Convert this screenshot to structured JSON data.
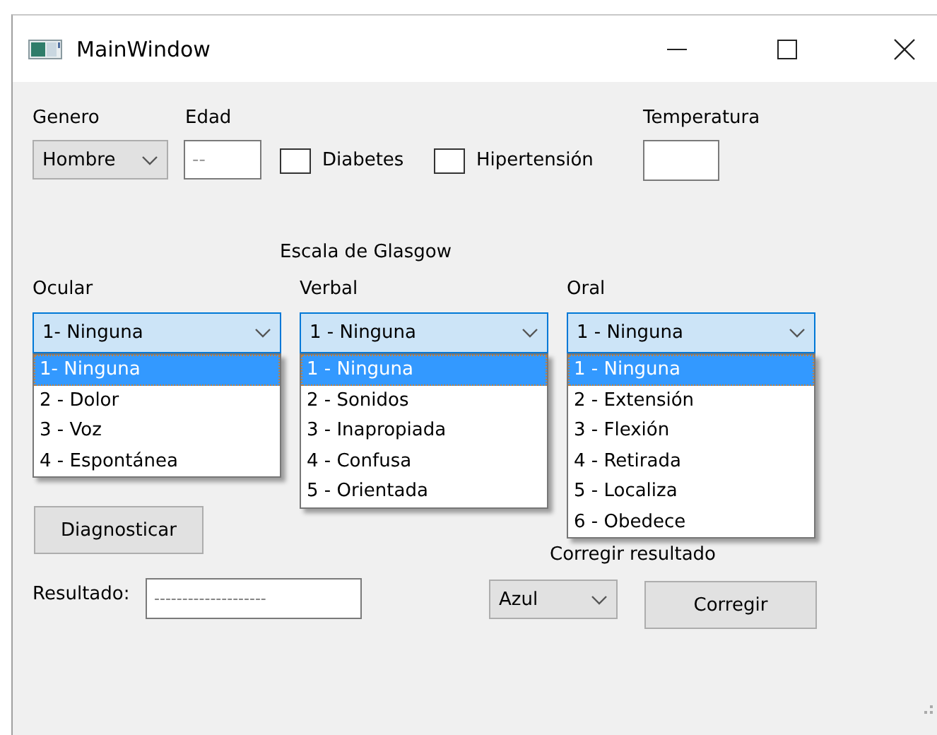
{
  "window": {
    "title": "MainWindow"
  },
  "genero": {
    "label": "Genero",
    "value": "Hombre"
  },
  "edad": {
    "label": "Edad",
    "placeholder": "--"
  },
  "checkboxes": [
    {
      "label": "Diabetes",
      "checked": false
    },
    {
      "label": "Hipertensión",
      "checked": false
    }
  ],
  "temperatura": {
    "label": "Temperatura"
  },
  "glasgow_title": "Escala de Glasgow",
  "scales": [
    {
      "label": "Ocular",
      "value": "1- Ninguna",
      "expanded": true,
      "options": [
        {
          "text": "1- Ninguna",
          "selected": true
        },
        {
          "text": "2 - Dolor",
          "selected": false
        },
        {
          "text": "3 - Voz",
          "selected": false
        },
        {
          "text": "4 - Espontánea",
          "selected": false
        }
      ]
    },
    {
      "label": "Verbal",
      "value": "1 - Ninguna",
      "expanded": true,
      "options": [
        {
          "text": "1 - Ninguna",
          "selected": true
        },
        {
          "text": "2 - Sonidos",
          "selected": false
        },
        {
          "text": "3 - Inapropiada",
          "selected": false
        },
        {
          "text": "4 - Confusa",
          "selected": false
        },
        {
          "text": "5 - Orientada",
          "selected": false
        }
      ]
    },
    {
      "label": "Oral",
      "value": "1 - Ninguna",
      "expanded": true,
      "options": [
        {
          "text": "1 - Ninguna",
          "selected": true
        },
        {
          "text": "2 - Extensión",
          "selected": false
        },
        {
          "text": "3 - Flexión",
          "selected": false
        },
        {
          "text": "4 - Retirada",
          "selected": false
        },
        {
          "text": "5 - Localiza",
          "selected": false
        },
        {
          "text": "6 - Obedece",
          "selected": false
        }
      ]
    }
  ],
  "diagnose_button": "Diagnosticar",
  "resultado": {
    "label": "Resultado:",
    "placeholder": "--------------------"
  },
  "corregir": {
    "label": "Corregir resultado",
    "value": "Azul",
    "button": "Corregir"
  }
}
